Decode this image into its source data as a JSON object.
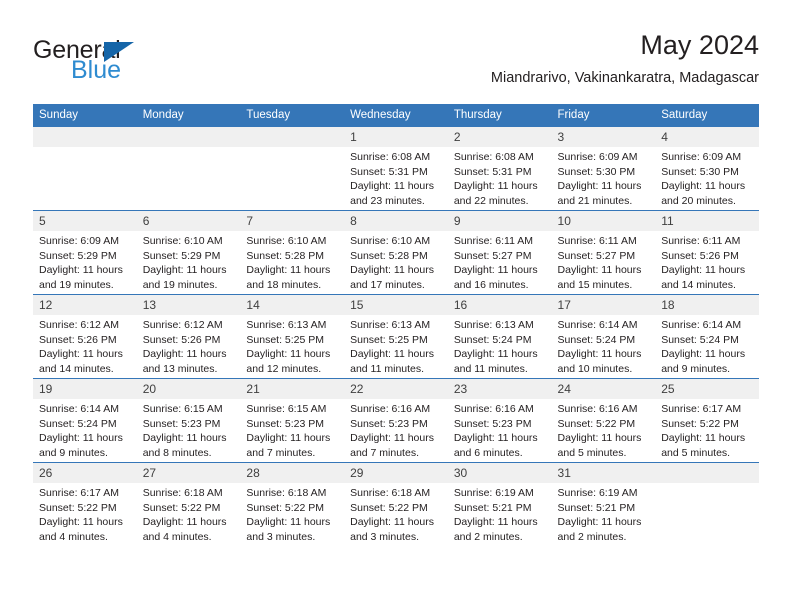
{
  "brand": {
    "name_top": "General",
    "name_bottom": "Blue",
    "accent_color": "#1565a8",
    "blue_color": "#2e8bd0"
  },
  "header": {
    "month_title": "May 2024",
    "location": "Miandrarivo, Vakinankaratra, Madagascar"
  },
  "calendar": {
    "header_bg": "#3576b8",
    "daynum_bg": "#f0f0f0",
    "weekdays": [
      "Sunday",
      "Monday",
      "Tuesday",
      "Wednesday",
      "Thursday",
      "Friday",
      "Saturday"
    ],
    "weeks": [
      [
        {
          "day": "",
          "empty": true
        },
        {
          "day": "",
          "empty": true
        },
        {
          "day": "",
          "empty": true
        },
        {
          "day": "1",
          "sunrise": "Sunrise: 6:08 AM",
          "sunset": "Sunset: 5:31 PM",
          "daylight_line1": "Daylight: 11 hours",
          "daylight_line2": "and 23 minutes."
        },
        {
          "day": "2",
          "sunrise": "Sunrise: 6:08 AM",
          "sunset": "Sunset: 5:31 PM",
          "daylight_line1": "Daylight: 11 hours",
          "daylight_line2": "and 22 minutes."
        },
        {
          "day": "3",
          "sunrise": "Sunrise: 6:09 AM",
          "sunset": "Sunset: 5:30 PM",
          "daylight_line1": "Daylight: 11 hours",
          "daylight_line2": "and 21 minutes."
        },
        {
          "day": "4",
          "sunrise": "Sunrise: 6:09 AM",
          "sunset": "Sunset: 5:30 PM",
          "daylight_line1": "Daylight: 11 hours",
          "daylight_line2": "and 20 minutes."
        }
      ],
      [
        {
          "day": "5",
          "sunrise": "Sunrise: 6:09 AM",
          "sunset": "Sunset: 5:29 PM",
          "daylight_line1": "Daylight: 11 hours",
          "daylight_line2": "and 19 minutes."
        },
        {
          "day": "6",
          "sunrise": "Sunrise: 6:10 AM",
          "sunset": "Sunset: 5:29 PM",
          "daylight_line1": "Daylight: 11 hours",
          "daylight_line2": "and 19 minutes."
        },
        {
          "day": "7",
          "sunrise": "Sunrise: 6:10 AM",
          "sunset": "Sunset: 5:28 PM",
          "daylight_line1": "Daylight: 11 hours",
          "daylight_line2": "and 18 minutes."
        },
        {
          "day": "8",
          "sunrise": "Sunrise: 6:10 AM",
          "sunset": "Sunset: 5:28 PM",
          "daylight_line1": "Daylight: 11 hours",
          "daylight_line2": "and 17 minutes."
        },
        {
          "day": "9",
          "sunrise": "Sunrise: 6:11 AM",
          "sunset": "Sunset: 5:27 PM",
          "daylight_line1": "Daylight: 11 hours",
          "daylight_line2": "and 16 minutes."
        },
        {
          "day": "10",
          "sunrise": "Sunrise: 6:11 AM",
          "sunset": "Sunset: 5:27 PM",
          "daylight_line1": "Daylight: 11 hours",
          "daylight_line2": "and 15 minutes."
        },
        {
          "day": "11",
          "sunrise": "Sunrise: 6:11 AM",
          "sunset": "Sunset: 5:26 PM",
          "daylight_line1": "Daylight: 11 hours",
          "daylight_line2": "and 14 minutes."
        }
      ],
      [
        {
          "day": "12",
          "sunrise": "Sunrise: 6:12 AM",
          "sunset": "Sunset: 5:26 PM",
          "daylight_line1": "Daylight: 11 hours",
          "daylight_line2": "and 14 minutes."
        },
        {
          "day": "13",
          "sunrise": "Sunrise: 6:12 AM",
          "sunset": "Sunset: 5:26 PM",
          "daylight_line1": "Daylight: 11 hours",
          "daylight_line2": "and 13 minutes."
        },
        {
          "day": "14",
          "sunrise": "Sunrise: 6:13 AM",
          "sunset": "Sunset: 5:25 PM",
          "daylight_line1": "Daylight: 11 hours",
          "daylight_line2": "and 12 minutes."
        },
        {
          "day": "15",
          "sunrise": "Sunrise: 6:13 AM",
          "sunset": "Sunset: 5:25 PM",
          "daylight_line1": "Daylight: 11 hours",
          "daylight_line2": "and 11 minutes."
        },
        {
          "day": "16",
          "sunrise": "Sunrise: 6:13 AM",
          "sunset": "Sunset: 5:24 PM",
          "daylight_line1": "Daylight: 11 hours",
          "daylight_line2": "and 11 minutes."
        },
        {
          "day": "17",
          "sunrise": "Sunrise: 6:14 AM",
          "sunset": "Sunset: 5:24 PM",
          "daylight_line1": "Daylight: 11 hours",
          "daylight_line2": "and 10 minutes."
        },
        {
          "day": "18",
          "sunrise": "Sunrise: 6:14 AM",
          "sunset": "Sunset: 5:24 PM",
          "daylight_line1": "Daylight: 11 hours",
          "daylight_line2": "and 9 minutes."
        }
      ],
      [
        {
          "day": "19",
          "sunrise": "Sunrise: 6:14 AM",
          "sunset": "Sunset: 5:24 PM",
          "daylight_line1": "Daylight: 11 hours",
          "daylight_line2": "and 9 minutes."
        },
        {
          "day": "20",
          "sunrise": "Sunrise: 6:15 AM",
          "sunset": "Sunset: 5:23 PM",
          "daylight_line1": "Daylight: 11 hours",
          "daylight_line2": "and 8 minutes."
        },
        {
          "day": "21",
          "sunrise": "Sunrise: 6:15 AM",
          "sunset": "Sunset: 5:23 PM",
          "daylight_line1": "Daylight: 11 hours",
          "daylight_line2": "and 7 minutes."
        },
        {
          "day": "22",
          "sunrise": "Sunrise: 6:16 AM",
          "sunset": "Sunset: 5:23 PM",
          "daylight_line1": "Daylight: 11 hours",
          "daylight_line2": "and 7 minutes."
        },
        {
          "day": "23",
          "sunrise": "Sunrise: 6:16 AM",
          "sunset": "Sunset: 5:23 PM",
          "daylight_line1": "Daylight: 11 hours",
          "daylight_line2": "and 6 minutes."
        },
        {
          "day": "24",
          "sunrise": "Sunrise: 6:16 AM",
          "sunset": "Sunset: 5:22 PM",
          "daylight_line1": "Daylight: 11 hours",
          "daylight_line2": "and 5 minutes."
        },
        {
          "day": "25",
          "sunrise": "Sunrise: 6:17 AM",
          "sunset": "Sunset: 5:22 PM",
          "daylight_line1": "Daylight: 11 hours",
          "daylight_line2": "and 5 minutes."
        }
      ],
      [
        {
          "day": "26",
          "sunrise": "Sunrise: 6:17 AM",
          "sunset": "Sunset: 5:22 PM",
          "daylight_line1": "Daylight: 11 hours",
          "daylight_line2": "and 4 minutes."
        },
        {
          "day": "27",
          "sunrise": "Sunrise: 6:18 AM",
          "sunset": "Sunset: 5:22 PM",
          "daylight_line1": "Daylight: 11 hours",
          "daylight_line2": "and 4 minutes."
        },
        {
          "day": "28",
          "sunrise": "Sunrise: 6:18 AM",
          "sunset": "Sunset: 5:22 PM",
          "daylight_line1": "Daylight: 11 hours",
          "daylight_line2": "and 3 minutes."
        },
        {
          "day": "29",
          "sunrise": "Sunrise: 6:18 AM",
          "sunset": "Sunset: 5:22 PM",
          "daylight_line1": "Daylight: 11 hours",
          "daylight_line2": "and 3 minutes."
        },
        {
          "day": "30",
          "sunrise": "Sunrise: 6:19 AM",
          "sunset": "Sunset: 5:21 PM",
          "daylight_line1": "Daylight: 11 hours",
          "daylight_line2": "and 2 minutes."
        },
        {
          "day": "31",
          "sunrise": "Sunrise: 6:19 AM",
          "sunset": "Sunset: 5:21 PM",
          "daylight_line1": "Daylight: 11 hours",
          "daylight_line2": "and 2 minutes."
        },
        {
          "day": "",
          "empty": true
        }
      ]
    ]
  }
}
